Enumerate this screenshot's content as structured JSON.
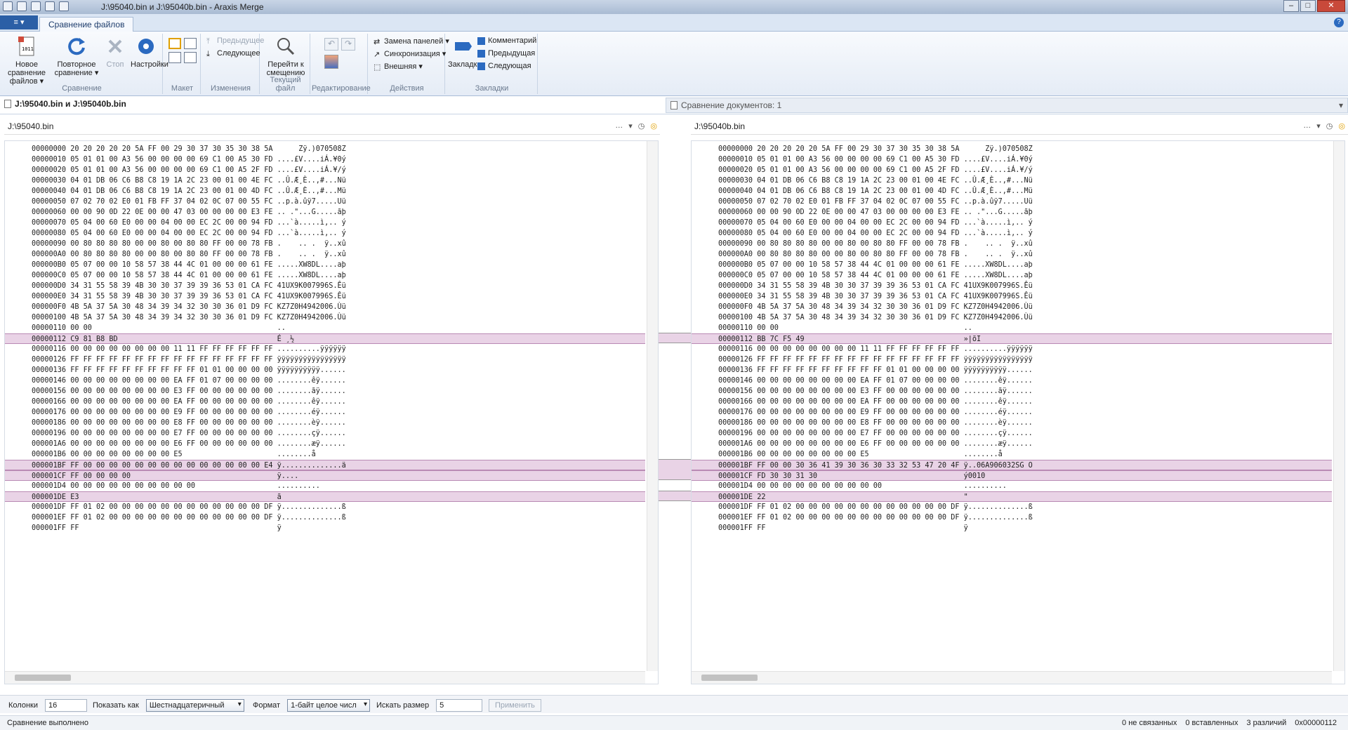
{
  "window": {
    "title": "J:\\95040.bin и J:\\95040b.bin - Araxis Merge"
  },
  "ribbon_tab": "Сравнение файлов",
  "ribbon": {
    "new_compare": "Новое сравнение файлов ▾",
    "recompare": "Повторное сравнение ▾",
    "stop": "Стоп",
    "settings": "Настройки",
    "grp_compare": "Сравнение",
    "grp_layout": "Макет",
    "prev_change": "Предыдущее",
    "next_change": "Следующее",
    "grp_changes": "Изменения",
    "goto_offset": "Перейти к смещению",
    "grp_current": "Текущий файл",
    "grp_edit": "Редактирование",
    "swap_panes": "Замена панелей ▾",
    "sync": "Синхронизация ▾",
    "external": "Внешняя ▾",
    "grp_actions": "Действия",
    "bookmark": "Закладка",
    "comment": "Комментарий",
    "prev_bm": "Предыдущая",
    "next_bm": "Следующая",
    "grp_bookmarks": "Закладки"
  },
  "file_tab_active": "J:\\95040.bin и J:\\95040b.bin",
  "file_tab_other": "Сравнение документов: 1",
  "left_path": "J:\\95040.bin",
  "right_path": "J:\\95040b.bin",
  "path_dots": "…",
  "left_lines": [
    {
      "t": "00000000 20 20 20 20 20 5A FF 00 29 30 37 30 35 30 38 5A      Zÿ.)070508Z"
    },
    {
      "t": "00000010 05 01 01 00 A3 56 00 00 00 00 69 C1 00 A5 30 FD ....£V....iÁ.¥0ý"
    },
    {
      "t": "00000020 05 01 01 00 A3 56 00 00 00 00 69 C1 00 A5 2F FD ....£V....iÁ.¥/ý"
    },
    {
      "t": "00000030 04 01 DB 06 C6 B8 C8 19 1A 2C 23 00 01 00 4E FC ..Û.Æ¸È..,#...Nü"
    },
    {
      "t": "00000040 04 01 DB 06 C6 B8 C8 19 1A 2C 23 00 01 00 4D FC ..Û.Æ¸È..,#...Mü"
    },
    {
      "t": "00000050 07 02 70 02 E0 01 FB FF 37 04 02 0C 07 00 55 FC ..p.à.ûÿ7.....Uü"
    },
    {
      "t": "00000060 00 00 90 0D 22 0E 00 00 47 03 00 00 00 00 E3 FE .. .\"...G.....ãþ"
    },
    {
      "t": "00000070 05 04 00 60 E0 00 00 04 00 00 EC 2C 00 00 94 FD ...`à.....ì,.. ý"
    },
    {
      "t": "00000080 05 04 00 60 E0 00 00 04 00 00 EC 2C 00 00 94 FD ...`à.....ì,.. ý"
    },
    {
      "t": "00000090 00 80 80 80 80 00 00 80 00 80 80 FF 00 00 78 FB .    .. .  ÿ..xû"
    },
    {
      "t": "000000A0 00 80 80 80 80 00 00 80 00 80 80 FF 00 00 78 FB .    .. .  ÿ..xû"
    },
    {
      "t": "000000B0 05 07 00 00 10 58 57 38 44 4C 01 00 00 00 61 FE .....XW8DL....aþ"
    },
    {
      "t": "000000C0 05 07 00 00 10 58 57 38 44 4C 01 00 00 00 61 FE .....XW8DL....aþ"
    },
    {
      "t": "000000D0 34 31 55 58 39 4B 30 30 37 39 39 36 53 01 CA FC 41UX9K007996S.Êü"
    },
    {
      "t": "000000E0 34 31 55 58 39 4B 30 30 37 39 39 36 53 01 CA FC 41UX9K007996S.Êü"
    },
    {
      "t": "000000F0 4B 5A 37 5A 30 48 34 39 34 32 30 30 36 01 D9 FC KZ7Z0H4942006.Ùü"
    },
    {
      "t": "00000100 4B 5A 37 5A 30 48 34 39 34 32 30 30 36 01 D9 FC KZ7Z0H4942006.Ùü"
    },
    {
      "t": "00000110 00 00                                           .."
    },
    {
      "t": "00000112 C9 81 B8 BD                                     É ¸½",
      "d": true
    },
    {
      "t": "00000116 00 00 00 00 00 00 00 00 11 11 FF FF FF FF FF FF ..........ÿÿÿÿÿÿ"
    },
    {
      "t": "00000126 FF FF FF FF FF FF FF FF FF FF FF FF FF FF FF FF ÿÿÿÿÿÿÿÿÿÿÿÿÿÿÿÿ"
    },
    {
      "t": "00000136 FF FF FF FF FF FF FF FF FF FF 01 01 00 00 00 00 ÿÿÿÿÿÿÿÿÿÿ......"
    },
    {
      "t": "00000146 00 00 00 00 00 00 00 00 EA FF 01 07 00 00 00 00 ........êÿ......"
    },
    {
      "t": "00000156 00 00 00 00 00 00 00 00 E3 FF 00 00 00 00 00 00 ........ãÿ......"
    },
    {
      "t": "00000166 00 00 00 00 00 00 00 00 EA FF 00 00 00 00 00 00 ........êÿ......"
    },
    {
      "t": "00000176 00 00 00 00 00 00 00 00 E9 FF 00 00 00 00 00 00 ........éÿ......"
    },
    {
      "t": "00000186 00 00 00 00 00 00 00 00 E8 FF 00 00 00 00 00 00 ........èÿ......"
    },
    {
      "t": "00000196 00 00 00 00 00 00 00 00 E7 FF 00 00 00 00 00 00 ........çÿ......"
    },
    {
      "t": "000001A6 00 00 00 00 00 00 00 00 E6 FF 00 00 00 00 00 00 ........æÿ......"
    },
    {
      "t": "000001B6 00 00 00 00 00 00 00 00 E5                      ........å"
    },
    {
      "t": "000001BF FF 00 00 00 00 00 00 00 00 00 00 00 00 00 00 E4 ÿ..............ä",
      "d": true
    },
    {
      "t": "000001CF FF 00 00 00 00                                  ÿ....",
      "d": true
    },
    {
      "t": "000001D4 00 00 00 00 00 00 00 00 00 00                   .........."
    },
    {
      "t": "000001DE E3                                              ã",
      "d": true
    },
    {
      "t": "000001DF FF 01 02 00 00 00 00 00 00 00 00 00 00 00 00 DF ÿ..............ß"
    },
    {
      "t": "000001EF FF 01 02 00 00 00 00 00 00 00 00 00 00 00 00 DF ÿ..............ß"
    },
    {
      "t": "000001FF FF                                              ÿ"
    }
  ],
  "right_lines": [
    {
      "t": "00000000 20 20 20 20 20 5A FF 00 29 30 37 30 35 30 38 5A      Zÿ.)070508Z"
    },
    {
      "t": "00000010 05 01 01 00 A3 56 00 00 00 00 69 C1 00 A5 30 FD ....£V....iÁ.¥0ý"
    },
    {
      "t": "00000020 05 01 01 00 A3 56 00 00 00 00 69 C1 00 A5 2F FD ....£V....iÁ.¥/ý"
    },
    {
      "t": "00000030 04 01 DB 06 C6 B8 C8 19 1A 2C 23 00 01 00 4E FC ..Û.Æ¸È..,#...Nü"
    },
    {
      "t": "00000040 04 01 DB 06 C6 B8 C8 19 1A 2C 23 00 01 00 4D FC ..Û.Æ¸È..,#...Mü"
    },
    {
      "t": "00000050 07 02 70 02 E0 01 FB FF 37 04 02 0C 07 00 55 FC ..p.à.ûÿ7.....Uü"
    },
    {
      "t": "00000060 00 00 90 0D 22 0E 00 00 47 03 00 00 00 00 E3 FE .. .\"...G.....ãþ"
    },
    {
      "t": "00000070 05 04 00 60 E0 00 00 04 00 00 EC 2C 00 00 94 FD ...`à.....ì,.. ý"
    },
    {
      "t": "00000080 05 04 00 60 E0 00 00 04 00 00 EC 2C 00 00 94 FD ...`à.....ì,.. ý"
    },
    {
      "t": "00000090 00 80 80 80 80 00 00 80 00 80 80 FF 00 00 78 FB .    .. .  ÿ..xû"
    },
    {
      "t": "000000A0 00 80 80 80 80 00 00 80 00 80 80 FF 00 00 78 FB .    .. .  ÿ..xû"
    },
    {
      "t": "000000B0 05 07 00 00 10 58 57 38 44 4C 01 00 00 00 61 FE .....XW8DL....aþ"
    },
    {
      "t": "000000C0 05 07 00 00 10 58 57 38 44 4C 01 00 00 00 61 FE .....XW8DL....aþ"
    },
    {
      "t": "000000D0 34 31 55 58 39 4B 30 30 37 39 39 36 53 01 CA FC 41UX9K007996S.Êü"
    },
    {
      "t": "000000E0 34 31 55 58 39 4B 30 30 37 39 39 36 53 01 CA FC 41UX9K007996S.Êü"
    },
    {
      "t": "000000F0 4B 5A 37 5A 30 48 34 39 34 32 30 30 36 01 D9 FC KZ7Z0H4942006.Ùü"
    },
    {
      "t": "00000100 4B 5A 37 5A 30 48 34 39 34 32 30 30 36 01 D9 FC KZ7Z0H4942006.Ùü"
    },
    {
      "t": "00000110 00 00                                           .."
    },
    {
      "t": "00000112 BB 7C F5 49                                     »|õI",
      "d": true
    },
    {
      "t": "00000116 00 00 00 00 00 00 00 00 11 11 FF FF FF FF FF FF ..........ÿÿÿÿÿÿ"
    },
    {
      "t": "00000126 FF FF FF FF FF FF FF FF FF FF FF FF FF FF FF FF ÿÿÿÿÿÿÿÿÿÿÿÿÿÿÿÿ"
    },
    {
      "t": "00000136 FF FF FF FF FF FF FF FF FF FF 01 01 00 00 00 00 ÿÿÿÿÿÿÿÿÿÿ......"
    },
    {
      "t": "00000146 00 00 00 00 00 00 00 00 EA FF 01 07 00 00 00 00 ........êÿ......"
    },
    {
      "t": "00000156 00 00 00 00 00 00 00 00 E3 FF 00 00 00 00 00 00 ........ãÿ......"
    },
    {
      "t": "00000166 00 00 00 00 00 00 00 00 EA FF 00 00 00 00 00 00 ........êÿ......"
    },
    {
      "t": "00000176 00 00 00 00 00 00 00 00 E9 FF 00 00 00 00 00 00 ........éÿ......"
    },
    {
      "t": "00000186 00 00 00 00 00 00 00 00 E8 FF 00 00 00 00 00 00 ........èÿ......"
    },
    {
      "t": "00000196 00 00 00 00 00 00 00 00 E7 FF 00 00 00 00 00 00 ........çÿ......"
    },
    {
      "t": "000001A6 00 00 00 00 00 00 00 00 E6 FF 00 00 00 00 00 00 ........æÿ......"
    },
    {
      "t": "000001B6 00 00 00 00 00 00 00 00 E5                      ........å"
    },
    {
      "t": "000001BF FF 00 00 30 36 41 39 30 36 30 33 32 53 47 20 4F ÿ..06A906032SG O",
      "d": true
    },
    {
      "t": "000001CF FD 30 30 31 30                                  ý0010",
      "d": true
    },
    {
      "t": "000001D4 00 00 00 00 00 00 00 00 00 00                   .........."
    },
    {
      "t": "000001DE 22                                              \"",
      "d": true
    },
    {
      "t": "000001DF FF 01 02 00 00 00 00 00 00 00 00 00 00 00 00 DF ÿ..............ß"
    },
    {
      "t": "000001EF FF 01 02 00 00 00 00 00 00 00 00 00 00 00 00 DF ÿ..............ß"
    },
    {
      "t": "000001FF FF                                              ÿ"
    }
  ],
  "bottom": {
    "columns_label": "Колонки",
    "columns_value": "16",
    "show_as_label": "Показать как",
    "show_as_value": "Шестнадцатеричный",
    "format_label": "Формат",
    "format_value": "1-байт целое числ",
    "search_size_label": "Искать размер",
    "search_size_value": "5",
    "apply": "Применить"
  },
  "status": {
    "left": "Сравнение выполнено",
    "unlinked": "0 не связанных",
    "inserted": "0 вставленных",
    "differences": "3 различий",
    "offset": "0x00000112"
  },
  "colors": {
    "diff_bg": "#e9d3e6",
    "accent": "#2b5fa6"
  }
}
